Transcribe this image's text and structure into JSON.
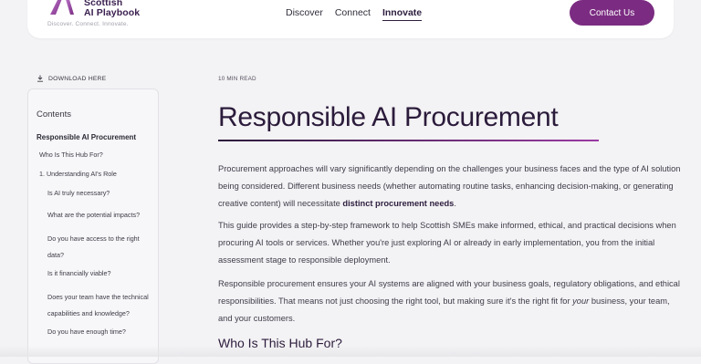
{
  "header": {
    "logo": {
      "line1": "Scottish",
      "line2": "AI Playbook",
      "tagline": "Discover. Connect. Innovate."
    },
    "nav": [
      {
        "label": "Discover",
        "active": false
      },
      {
        "label": "Connect",
        "active": false
      },
      {
        "label": "Innovate",
        "active": true
      }
    ],
    "cta_label": "Contact Us"
  },
  "sidebar": {
    "download_label": "DOWNLOAD HERE",
    "contents_title": "Contents",
    "items": [
      {
        "label": "Responsible AI Procurement",
        "level": 0
      },
      {
        "label": "Who Is This Hub For?",
        "level": 1
      },
      {
        "label": "1. Understanding AI's Role",
        "level": 1
      },
      {
        "label": "Is AI truly necessary?",
        "level": 2
      },
      {
        "label": "What are the potential impacts?",
        "level": 2
      },
      {
        "label": "Do you have access to the right data?",
        "level": 2
      },
      {
        "label": "Is it financially viable?",
        "level": 2
      },
      {
        "label": "Does your team have the technical capabilities and knowledge?",
        "level": 2
      },
      {
        "label": "Do you have enough time?",
        "level": 2
      }
    ]
  },
  "main": {
    "read_time": "10 MIN READ",
    "title": "Responsible AI Procurement",
    "p1_text": "Procurement approaches will vary significantly depending on the challenges your business faces and the type of AI solution being considered. Different business needs (whether automating routine tasks, enhancing decision-making, or generating creative content) will necessitate ",
    "p1_bold": "distinct procurement needs",
    "p1_end": ".",
    "p2": "This guide provides a step-by-step framework to help Scottish SMEs make informed, ethical, and practical decisions when procuring AI tools or services. Whether you're just exploring AI or already in early implementation, you from the initial assessment stage to responsible deployment.",
    "p3_text": "Responsible procurement ensures your AI systems are aligned with your business goals, regulatory obligations, and ethical responsibilities. That means not just choosing the right tool, but making sure it's the right fit for ",
    "p3_italic": "your",
    "p3_end": " business, your team, and your customers.",
    "subheading": "Who Is This Hub For?"
  },
  "colors": {
    "accent": "#7b2c82",
    "heading": "#2b1b3b"
  }
}
